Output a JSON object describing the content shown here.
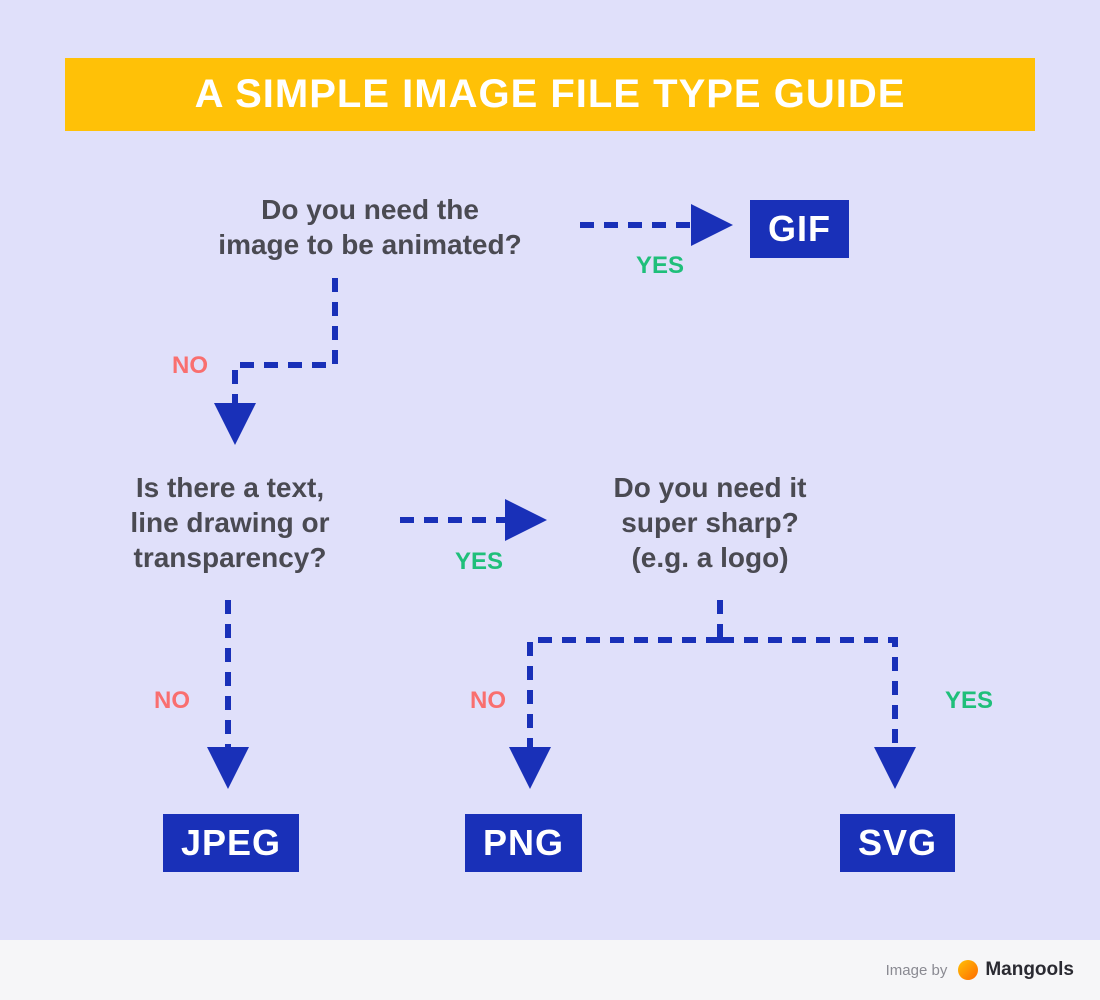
{
  "title": "A SIMPLE IMAGE FILE TYPE GUIDE",
  "questions": {
    "q1_line1": "Do you need the",
    "q1_line2": "image to be animated?",
    "q2_line1": "Is there a text,",
    "q2_line2": "line drawing or",
    "q2_line3": "transparency?",
    "q3_line1": "Do you need it",
    "q3_line2": "super sharp?",
    "q3_line3": "(e.g. a logo)"
  },
  "labels": {
    "yes": "YES",
    "no": "NO"
  },
  "results": {
    "gif": "GIF",
    "jpeg": "JPEG",
    "png": "PNG",
    "svg": "SVG"
  },
  "footer": {
    "credit": "Image by",
    "brand": "Mangools"
  },
  "colors": {
    "background": "#e0e0fa",
    "title_bg": "#ffc107",
    "title_fg": "#ffffff",
    "question_fg": "#4a4a52",
    "arrow": "#1930b8",
    "yes": "#1fbf7a",
    "no": "#f96f6f",
    "result_bg": "#1930b8",
    "result_fg": "#ffffff",
    "footer_bg": "#f6f6f8"
  }
}
